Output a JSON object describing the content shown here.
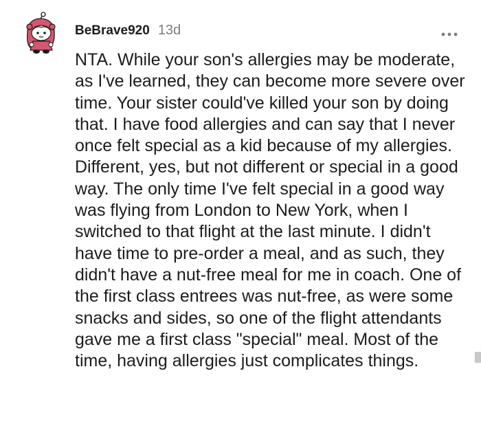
{
  "comment": {
    "username": "BeBrave920",
    "timestamp": "13d",
    "more_icon": "more-options-icon",
    "avatar_icon": "snoo-avatar-icon",
    "body": "NTA. While your son's allergies may be moderate, as I've learned, they can become more severe over time. Your sister could've killed your son by doing that. I have food allergies and can say that I never once felt special as a kid because of my allergies. Different, yes, but not different or special in a good way. The only time I've felt special in a good way was flying from London to New York, when I switched to that flight at the last minute. I didn't have time to pre-order a meal, and as such, they didn't have a nut-free meal for me in coach. One of the first class entrees was nut-free, as were some snacks and sides, so one of the flight attendants gave me a first class \"special\" meal. Most of the time, having allergies just complicates things."
  },
  "colors": {
    "text": "#1c1c1c",
    "meta": "#7c7c7c",
    "avatar_hood": "#d7566f",
    "avatar_face": "#ffffff"
  }
}
